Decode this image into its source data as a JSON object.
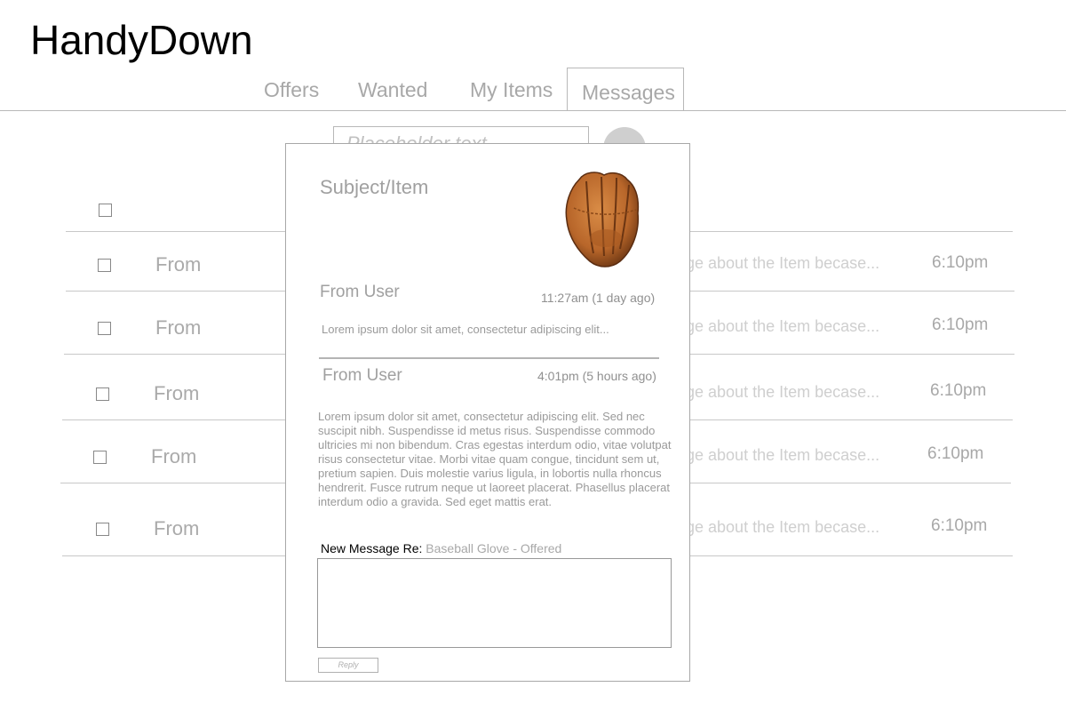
{
  "app": {
    "title": "HandyDown"
  },
  "tabs": [
    {
      "label": "Offers"
    },
    {
      "label": "Wanted"
    },
    {
      "label": "My Items"
    },
    {
      "label": "Messages",
      "active": true
    }
  ],
  "search": {
    "placeholder": "Placeholder text"
  },
  "messages": [
    {
      "from": "From",
      "preview": "ge about the Item becase...",
      "time": "6:10pm"
    },
    {
      "from": "From",
      "preview": "ge about the Item becase...",
      "time": "6:10pm"
    },
    {
      "from": "From",
      "preview": "ge about the Item becase...",
      "time": "6:10pm"
    },
    {
      "from": "From",
      "preview": "ge about the Item becase...",
      "time": "6:10pm"
    },
    {
      "from": "From",
      "preview": "ge about the Item becase...",
      "time": "6:10pm"
    }
  ],
  "modal": {
    "subject": "Subject/Item",
    "item_image": "baseball-glove",
    "thread": [
      {
        "from": "From User",
        "time": "11:27am (1 day ago)",
        "body": "Lorem ipsum dolor sit amet, consectetur adipiscing elit..."
      },
      {
        "from": "From User",
        "time": "4:01pm (5 hours ago)",
        "body": "Lorem ipsum dolor sit amet, consectetur adipiscing elit. Sed nec suscipit nibh. Suspendisse id metus risus. Suspendisse commodo ultricies mi non bibendum. Cras egestas interdum odio, vitae volutpat risus consectetur vitae. Morbi vitae quam congue, tincidunt sem ut, pretium sapien. Duis molestie varius ligula, in lobortis nulla rhoncus hendrerit. Fusce rutrum neque ut laoreet placerat. Phasellus placerat interdum odio a gravida. Sed eget mattis erat."
      }
    ],
    "new_message_label": "New Message Re:",
    "new_message_item": "Baseball Glove - Offered",
    "reply_label": "Reply"
  }
}
